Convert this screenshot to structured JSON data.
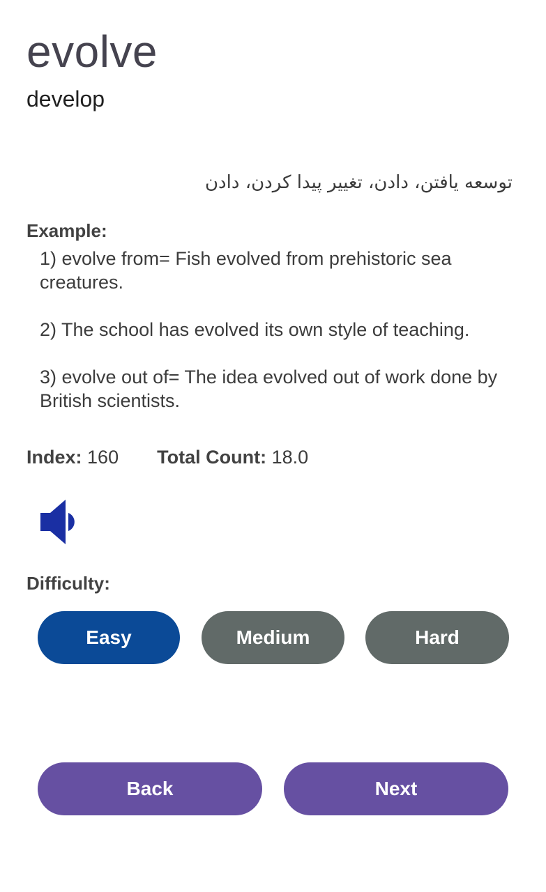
{
  "card": {
    "word": "evolve",
    "synonym": "develop",
    "translation": "توسعه یافتن، دادن، تغییر پیدا کردن، دادن",
    "example_heading": "Example:",
    "examples": [
      "1) evolve from= Fish evolved from prehistoric sea creatures.",
      " 2) The school has evolved its own style of teaching.",
      " 3) evolve out of= The idea evolved out of work done by British scientists."
    ],
    "index_label": "Index:",
    "index_value": "160",
    "total_label": "Total Count:",
    "total_value": "18.0",
    "speaker_icon": "volume-speaker-icon"
  },
  "difficulty": {
    "heading": "Difficulty:",
    "selected": "Easy",
    "buttons": [
      "Easy",
      "Medium",
      "Hard"
    ]
  },
  "navigation": {
    "back_label": "Back",
    "next_label": "Next"
  },
  "colors": {
    "selected_difficulty": "#0b4a97",
    "unselected_difficulty": "#616a68",
    "navigation": "#6650a2",
    "speaker_icon": "#1a2fa3"
  }
}
